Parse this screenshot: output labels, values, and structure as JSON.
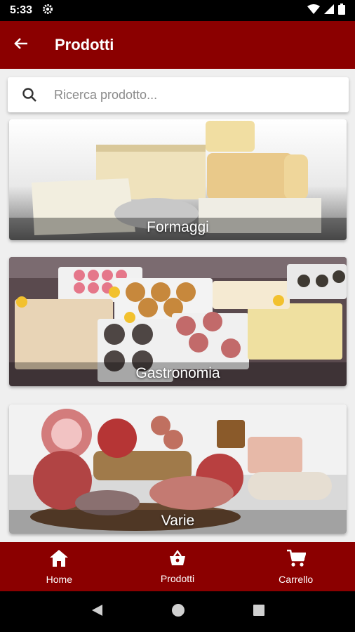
{
  "status_bar": {
    "time": "5:33"
  },
  "app_bar": {
    "title": "Prodotti"
  },
  "search": {
    "placeholder": "Ricerca prodotto..."
  },
  "categories": [
    {
      "label": "Formaggi"
    },
    {
      "label": "Gastronomia"
    },
    {
      "label": "Varie"
    }
  ],
  "bottom_nav": {
    "home": "Home",
    "products": "Prodotti",
    "cart": "Carrello"
  },
  "colors": {
    "primary": "#8b0000"
  }
}
